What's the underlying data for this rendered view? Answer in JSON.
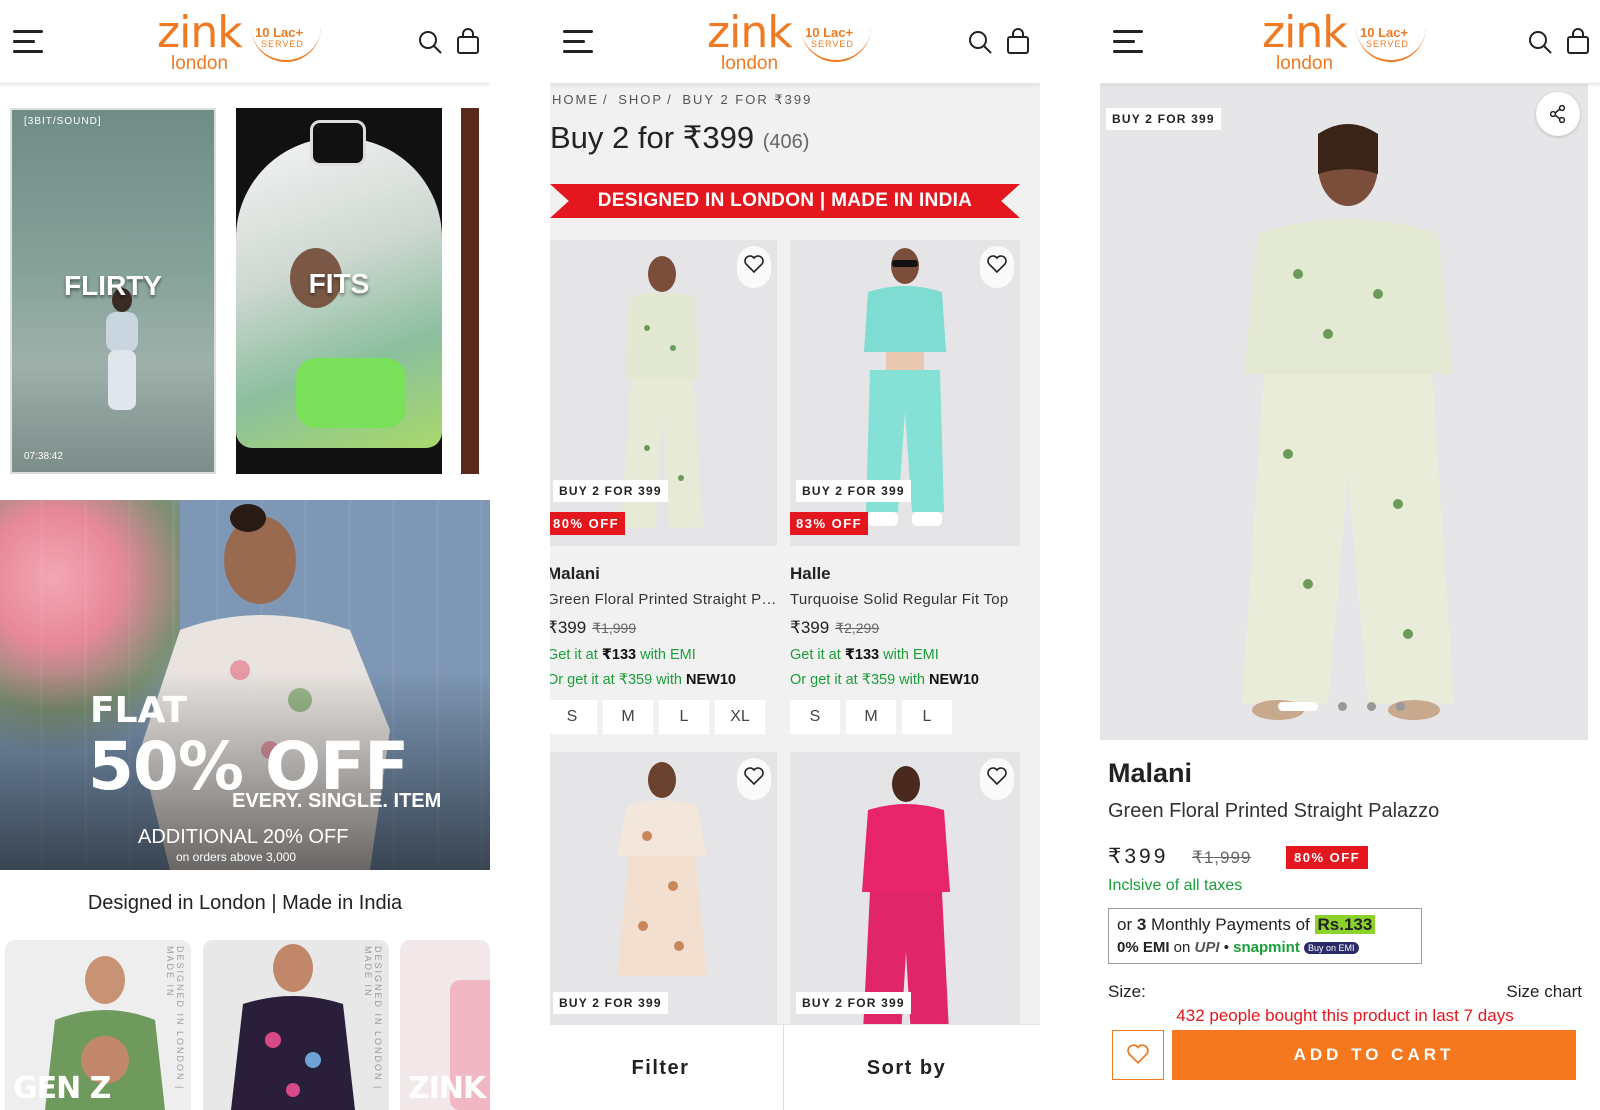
{
  "header": {
    "logo_main": "zink",
    "logo_sub": "london",
    "logo_badge": "10 Lac+",
    "logo_badge_sub": "SERVED"
  },
  "home": {
    "reels": [
      {
        "label": "FLIRTY",
        "top": "[3BIT/SOUND]",
        "time": "07:38:42"
      },
      {
        "label": "FITS"
      }
    ],
    "promo": {
      "flat": "FLAT",
      "big": "50% OFF",
      "every": "EVERY. SINGLE. ITEM",
      "additional": "ADDITIONAL 20% OFF",
      "above": "on orders above 3,000"
    },
    "tagline": "Designed in London | Made in India",
    "categories": [
      {
        "label": "GEN Z",
        "side": "DESIGNED IN LONDON | MADE IN"
      },
      {
        "label": "",
        "side": "DESIGNED IN LONDON | MADE IN"
      },
      {
        "label": "ZINK",
        "side": ""
      }
    ]
  },
  "listing": {
    "breadcrumb": [
      "HOME",
      "SHOP",
      "BUY 2 FOR ₹399"
    ],
    "title": "Buy 2 for ₹399",
    "count": "(406)",
    "ribbon": "DESIGNED IN LONDON | MADE IN INDIA",
    "products": [
      {
        "badge": "BUY 2 FOR 399",
        "off": "80% OFF",
        "name": "Malani",
        "desc": "Green Floral Printed Straight Palazzo",
        "price": "₹399",
        "mrp": "₹1,999",
        "emi_pre": "Get it at ",
        "emi_amt": "₹133",
        "emi_post": " with EMI",
        "offer_pre": "Or get it at ₹359 with ",
        "offer_code": "NEW10",
        "sizes": [
          "S",
          "M",
          "L",
          "XL"
        ]
      },
      {
        "badge": "BUY 2 FOR 399",
        "off": "83% OFF",
        "name": "Halle",
        "desc": "Turquoise Solid Regular Fit Top",
        "price": "₹399",
        "mrp": "₹2,299",
        "emi_pre": "Get it at ",
        "emi_amt": "₹133",
        "emi_post": " with EMI",
        "offer_pre": "Or get it at ₹359 with ",
        "offer_code": "NEW10",
        "sizes": [
          "S",
          "M",
          "L"
        ]
      },
      {
        "badge": "BUY 2 FOR 399"
      },
      {
        "badge": "BUY 2 FOR 399"
      }
    ],
    "filter_label": "Filter",
    "sort_label": "Sort by"
  },
  "detail": {
    "badge": "BUY 2 FOR 399",
    "name": "Malani",
    "desc": "Green Floral Printed Straight Palazzo",
    "price": "₹399",
    "mrp": "₹1,999",
    "off": "80% OFF",
    "tax": "Inclsive of all taxes",
    "emi_pre": "or ",
    "emi_num": "3",
    "emi_mid": " Monthly Payments of ",
    "emi_amt": "Rs.133",
    "emi_zero": "0% EMI",
    "emi_on": " on ",
    "upi": "UPI",
    "snapmint": "snapmint",
    "buy_on_emi": "Buy on EMI",
    "size_label": "Size:",
    "size_chart": "Size chart",
    "bought": "432 people bought this product in last 7 days",
    "add_to_cart": "ADD TO CART",
    "carousel_active": 1,
    "carousel_total": 4
  },
  "colors": {
    "brand_orange": "#f07a22",
    "sale_red": "#e3171d",
    "emi_green": "#1a9e3a",
    "cart_orange": "#f5781f"
  }
}
